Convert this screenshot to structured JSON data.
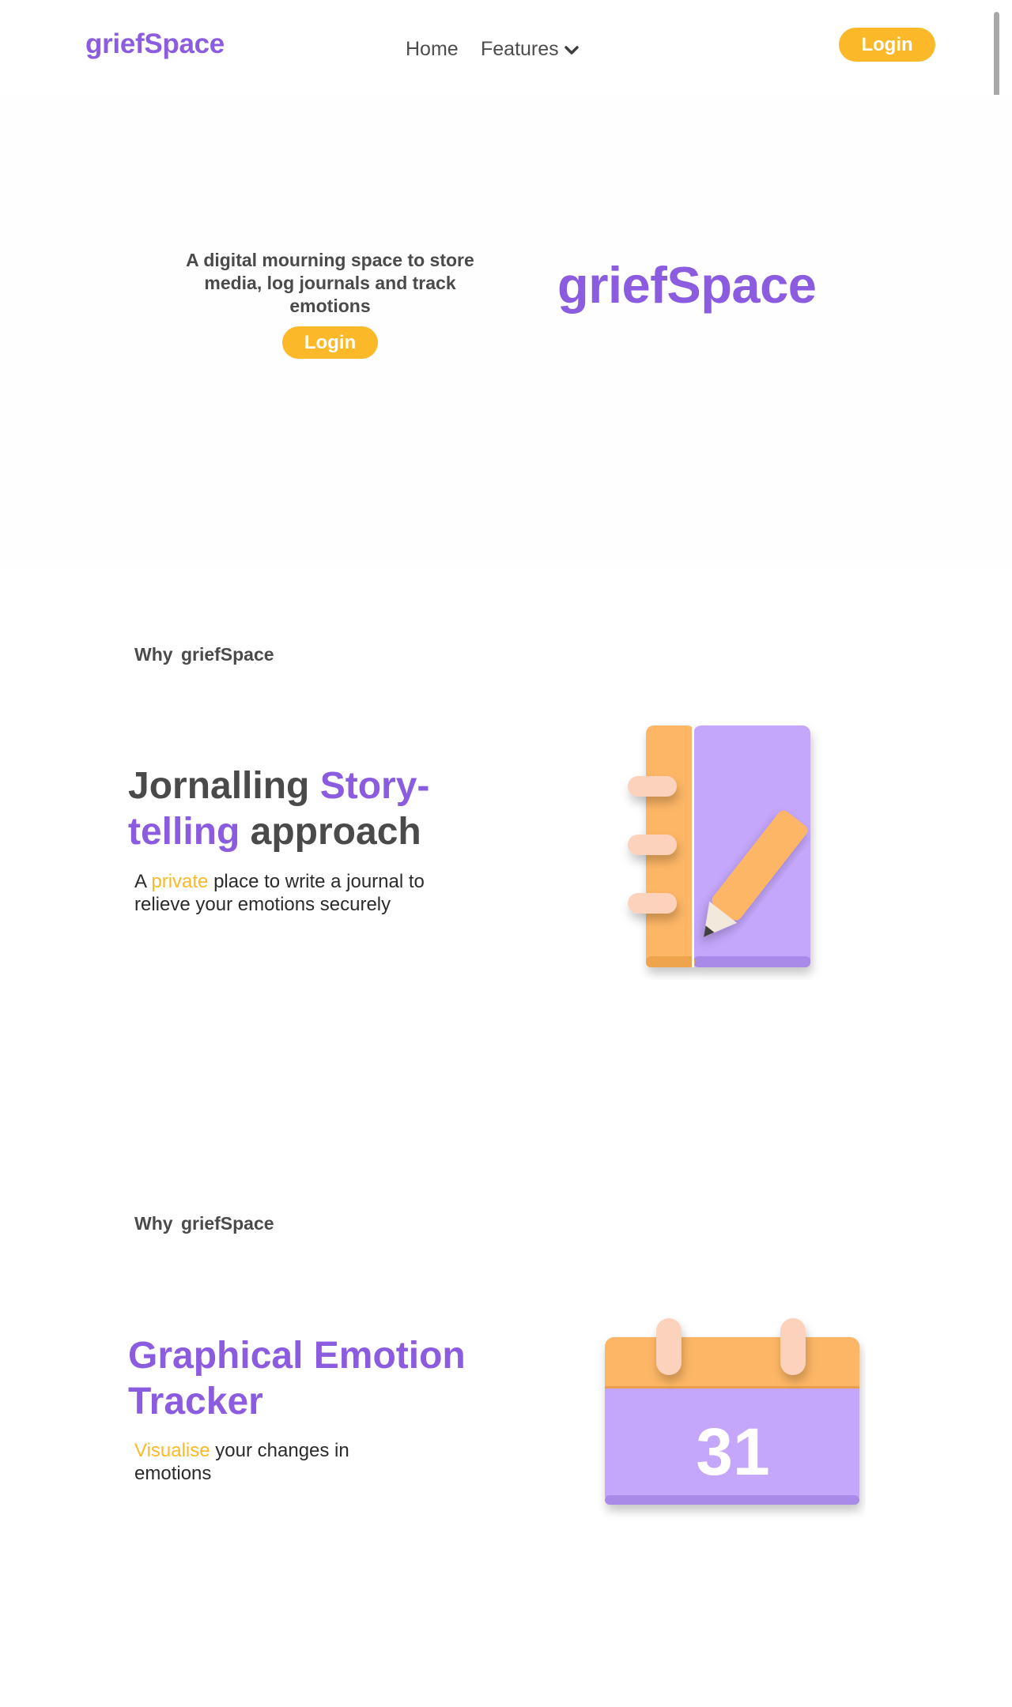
{
  "nav": {
    "brand": "griefSpace",
    "home_label": "Home",
    "features_label": "Features",
    "login_label": "Login"
  },
  "hero": {
    "tagline": "A digital mourning space to store media, log journals and track emotions",
    "login_label": "Login",
    "title": "griefSpace"
  },
  "features": [
    {
      "why_prefix": "Why",
      "why_brand": "griefSpace",
      "title_part1": "Jornalling ",
      "title_part2": "Story-telling",
      "title_part3": " approach",
      "desc_prefix": "A ",
      "desc_highlight": "private",
      "desc_rest": " place to write a journal to relieve your emotions securely"
    },
    {
      "why_prefix": "Why",
      "why_brand": "griefSpace",
      "title": "Graphical Emotion Tracker",
      "desc_highlight": "Visualise",
      "desc_rest": " your changes in emotions",
      "calendar_day": "31"
    }
  ],
  "icons": [
    "chevron-down-icon",
    "journal-pencil-icon",
    "calendar-icon"
  ],
  "colors": {
    "brand_purple": "#8b5cdf",
    "accent_yellow": "#fbb929",
    "orange": "#fdb665",
    "lavender": "#c4a6fb",
    "peach": "#fcd2bc"
  }
}
